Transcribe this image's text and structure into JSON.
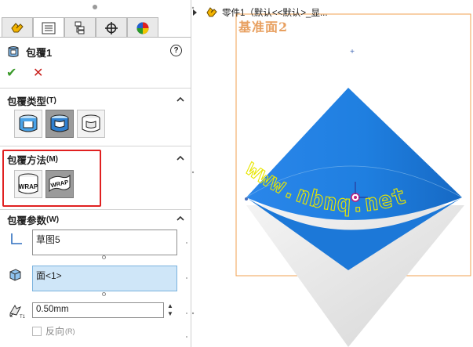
{
  "tabs": [
    {
      "name": "feature-manager-tab",
      "icon": "feature-icon"
    },
    {
      "name": "property-manager-tab",
      "icon": "property-list-icon"
    },
    {
      "name": "configuration-manager-tab",
      "icon": "configuration-icon"
    },
    {
      "name": "dimxpert-manager-tab",
      "icon": "crosshair-icon"
    },
    {
      "name": "display-manager-tab",
      "icon": "color-wheel-icon"
    }
  ],
  "feature": {
    "title": "包覆1",
    "help": "?",
    "ok": "✔",
    "cancel": "✕"
  },
  "wrap_type": {
    "heading": "包覆类型",
    "shortcut": "(T)",
    "options": [
      "emboss",
      "deboss",
      "scribe"
    ],
    "selected": "deboss"
  },
  "wrap_method": {
    "heading": "包覆方法",
    "shortcut": "(M)",
    "options": [
      {
        "name": "analytical",
        "text": "WRAP"
      },
      {
        "name": "spline-surface",
        "text": "WRAP"
      }
    ],
    "selected": "spline-surface"
  },
  "wrap_params": {
    "heading": "包覆参数",
    "shortcut": "(W)",
    "sketch_value": "草图5",
    "face_value": "面<1>",
    "thickness": "0.50mm",
    "reverse_label": "反向",
    "reverse_shortcut": "(R)",
    "reverse_checked": false
  },
  "viewport": {
    "tree_item": "零件1（默认<<默认>_显...",
    "plane_label": "基准面2",
    "watermark": "www.nbnq.net",
    "colors": {
      "cone": "#1f7fe0",
      "cone_shadow": "#d8d8d8",
      "plane_border": "#f0a050",
      "wrap_text": "#e8e600",
      "accent_red": "#e02020"
    }
  }
}
